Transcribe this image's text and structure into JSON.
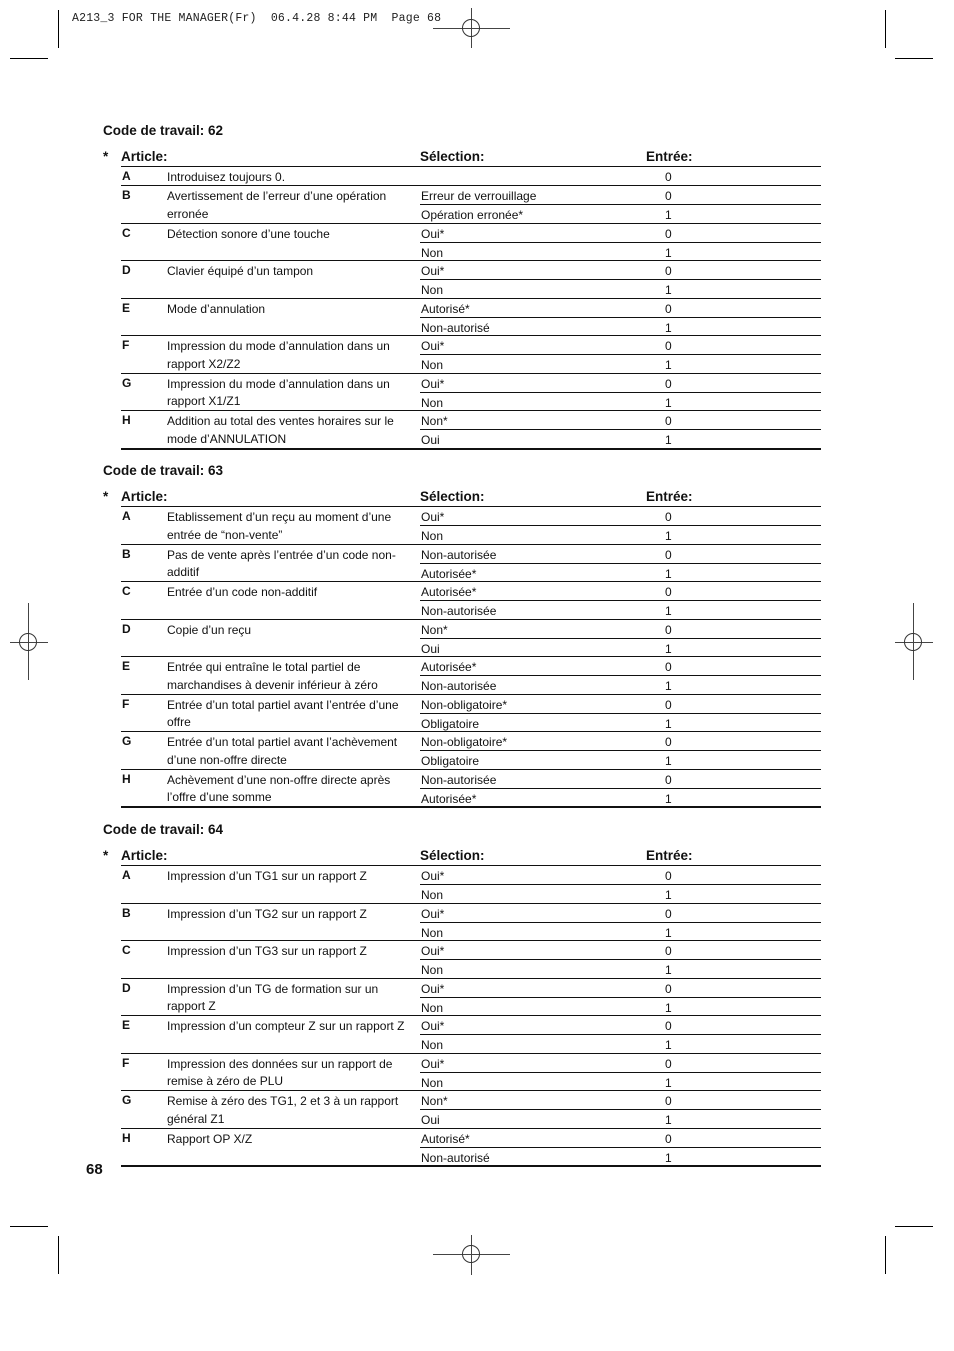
{
  "slug": {
    "text": "A213_3 FOR THE MANAGER(Fr)  06.4.28 8:44 PM  Page 68"
  },
  "headers": {
    "star": "*",
    "article": "Article:",
    "selection": "Sélection:",
    "entry": "Entrée:"
  },
  "sections": [
    {
      "title": "Code de travail: 62",
      "items": [
        {
          "letter": "A",
          "desc": "Introduisez toujours 0.",
          "options": [
            {
              "label": "",
              "value": "0"
            }
          ]
        },
        {
          "letter": "B",
          "desc": "Avertissement de l’erreur d’une opération erronée",
          "options": [
            {
              "label": "Erreur de verrouillage",
              "value": "0"
            },
            {
              "label": "Opération erronée*",
              "value": "1"
            }
          ]
        },
        {
          "letter": "C",
          "desc": "Détection sonore d’une touche",
          "options": [
            {
              "label": "Oui*",
              "value": "0"
            },
            {
              "label": "Non",
              "value": "1"
            }
          ]
        },
        {
          "letter": "D",
          "desc": "Clavier équipé d’un tampon",
          "options": [
            {
              "label": "Oui*",
              "value": "0"
            },
            {
              "label": "Non",
              "value": "1"
            }
          ]
        },
        {
          "letter": "E",
          "desc": "Mode d’annulation",
          "options": [
            {
              "label": "Autorisé*",
              "value": "0"
            },
            {
              "label": "Non-autorisé",
              "value": "1"
            }
          ]
        },
        {
          "letter": "F",
          "desc": "Impression du mode d’annulation dans un rapport X2/Z2",
          "options": [
            {
              "label": "Oui*",
              "value": "0"
            },
            {
              "label": "Non",
              "value": "1"
            }
          ]
        },
        {
          "letter": "G",
          "desc": "Impression du mode d’annulation dans un rapport X1/Z1",
          "options": [
            {
              "label": "Oui*",
              "value": "0"
            },
            {
              "label": "Non",
              "value": "1"
            }
          ]
        },
        {
          "letter": "H",
          "desc": "Addition au total des ventes horaires sur le mode d’ANNULATION",
          "options": [
            {
              "label": "Non*",
              "value": "0"
            },
            {
              "label": "Oui",
              "value": "1"
            }
          ]
        }
      ]
    },
    {
      "title": "Code de travail: 63",
      "items": [
        {
          "letter": "A",
          "desc": "Etablissement d’un reçu au moment d’une entrée de “non-vente”",
          "options": [
            {
              "label": "Oui*",
              "value": "0"
            },
            {
              "label": "Non",
              "value": "1"
            }
          ]
        },
        {
          "letter": "B",
          "desc": "Pas de vente après l’entrée d’un code non-additif",
          "options": [
            {
              "label": "Non-autorisée",
              "value": "0"
            },
            {
              "label": "Autorisée*",
              "value": "1"
            }
          ]
        },
        {
          "letter": "C",
          "desc": "Entrée d’un code non-additif",
          "options": [
            {
              "label": "Autorisée*",
              "value": "0"
            },
            {
              "label": "Non-autorisée",
              "value": "1"
            }
          ]
        },
        {
          "letter": "D",
          "desc": "Copie d’un reçu",
          "options": [
            {
              "label": "Non*",
              "value": "0"
            },
            {
              "label": "Oui",
              "value": "1"
            }
          ]
        },
        {
          "letter": "E",
          "desc": "Entrée qui entraîne le total partiel de marchandises à devenir inférieur à zéro",
          "options": [
            {
              "label": "Autorisée*",
              "value": "0"
            },
            {
              "label": "Non-autorisée",
              "value": "1"
            }
          ]
        },
        {
          "letter": "F",
          "desc": "Entrée d’un total partiel avant l’entrée d’une offre",
          "options": [
            {
              "label": "Non-obligatoire*",
              "value": "0"
            },
            {
              "label": "Obligatoire",
              "value": "1"
            }
          ]
        },
        {
          "letter": "G",
          "desc": "Entrée d’un total partiel avant l’achèvement d’une non-offre directe",
          "options": [
            {
              "label": "Non-obligatoire*",
              "value": "0"
            },
            {
              "label": "Obligatoire",
              "value": "1"
            }
          ]
        },
        {
          "letter": "H",
          "desc": "Achèvement d’une non-offre directe après l’offre d’une somme",
          "options": [
            {
              "label": "Non-autorisée",
              "value": "0"
            },
            {
              "label": "Autorisée*",
              "value": "1"
            }
          ]
        }
      ]
    },
    {
      "title": "Code de travail: 64",
      "items": [
        {
          "letter": "A",
          "desc": "Impression d’un TG1 sur un rapport Z",
          "options": [
            {
              "label": "Oui*",
              "value": "0"
            },
            {
              "label": "Non",
              "value": "1"
            }
          ]
        },
        {
          "letter": "B",
          "desc": "Impression d’un TG2 sur un rapport Z",
          "options": [
            {
              "label": "Oui*",
              "value": "0"
            },
            {
              "label": "Non",
              "value": "1"
            }
          ]
        },
        {
          "letter": "C",
          "desc": "Impression d’un TG3 sur un rapport Z",
          "options": [
            {
              "label": "Oui*",
              "value": "0"
            },
            {
              "label": "Non",
              "value": "1"
            }
          ]
        },
        {
          "letter": "D",
          "desc": "Impression d’un TG de formation sur un rapport Z",
          "options": [
            {
              "label": "Oui*",
              "value": "0"
            },
            {
              "label": "Non",
              "value": "1"
            }
          ]
        },
        {
          "letter": "E",
          "desc": "Impression d’un compteur Z sur un rapport Z",
          "options": [
            {
              "label": "Oui*",
              "value": "0"
            },
            {
              "label": "Non",
              "value": "1"
            }
          ]
        },
        {
          "letter": "F",
          "desc": "Impression des données sur un rapport de remise à zéro de PLU",
          "options": [
            {
              "label": "Oui*",
              "value": "0"
            },
            {
              "label": "Non",
              "value": "1"
            }
          ]
        },
        {
          "letter": "G",
          "desc": "Remise à zéro des TG1, 2 et 3 à un rapport général Z1",
          "options": [
            {
              "label": "Non*",
              "value": "0"
            },
            {
              "label": "Oui",
              "value": "1"
            }
          ]
        },
        {
          "letter": "H",
          "desc": "Rapport OP X/Z",
          "options": [
            {
              "label": "Autorisé*",
              "value": "0"
            },
            {
              "label": "Non-autorisé",
              "value": "1"
            }
          ]
        }
      ]
    }
  ],
  "footer": {
    "page_number": "68"
  }
}
